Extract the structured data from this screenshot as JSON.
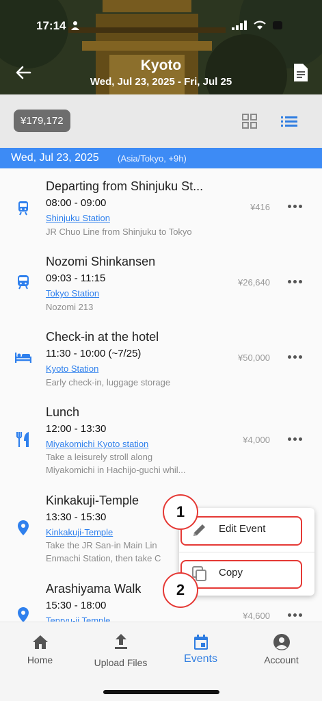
{
  "status_bar": {
    "time": "17:14"
  },
  "header": {
    "title": "Kyoto",
    "date_range": "Wed, Jul 23, 2025 - Fri, Jul 25"
  },
  "toolbar": {
    "total": "¥179,172",
    "accent": "#2f7de1"
  },
  "date_band": {
    "date": "Wed, Jul 23, 2025",
    "timezone": "(Asia/Tokyo, +9h)",
    "color": "#3d8bf5"
  },
  "events": [
    {
      "icon": "train-icon",
      "title": "Departing from Shinjuku St...",
      "time": "08:00 - 09:00",
      "place": "Shinjuku Station",
      "note": [
        "JR Chuo Line from Shinjuku to Tokyo"
      ],
      "price": "¥416"
    },
    {
      "icon": "shinkansen-icon",
      "title": "Nozomi Shinkansen",
      "time": "09:03 - 11:15",
      "place": "Tokyo Station",
      "note": [
        "Nozomi 213"
      ],
      "price": "¥26,640"
    },
    {
      "icon": "hotel-bed-icon",
      "title": "Check-in at the hotel",
      "time": "11:30 - 10:00 (~7/25)",
      "place": "Kyoto Station",
      "note": [
        "Early check-in, luggage storage"
      ],
      "price": "¥50,000"
    },
    {
      "icon": "restaurant-icon",
      "title": "Lunch",
      "time": "12:00 - 13:30",
      "place": "Miyakomichi Kyoto station",
      "note": [
        "Take a leisurely stroll along",
        "Miyakomichi in Hachijo-guchi whil..."
      ],
      "price": "¥4,000"
    },
    {
      "icon": "location-pin-icon",
      "title": "Kinkakuji-Temple",
      "time": "13:30 - 15:30",
      "place": "Kinkakuji-Temple",
      "note": [
        "Take the JR San-in Main Lin",
        "Enmachi Station, then take C"
      ],
      "price": ""
    },
    {
      "icon": "location-pin-icon",
      "title": "Arashiyama Walk",
      "time": "15:30 - 18:00",
      "place": "Tenryu-ji Temple",
      "note": [],
      "price": "¥4,600"
    }
  ],
  "context_menu": {
    "items": [
      {
        "label": "Edit Event",
        "icon": "pencil-icon"
      },
      {
        "label": "Copy",
        "icon": "copy-icon"
      }
    ],
    "annotations": [
      "1",
      "2"
    ]
  },
  "bottom_nav": [
    {
      "label": "Home",
      "icon": "home-icon"
    },
    {
      "label": "Upload Files",
      "icon": "upload-icon"
    },
    {
      "label": "Events",
      "icon": "calendar-icon",
      "active": true
    },
    {
      "label": "Account",
      "icon": "account-icon"
    }
  ]
}
